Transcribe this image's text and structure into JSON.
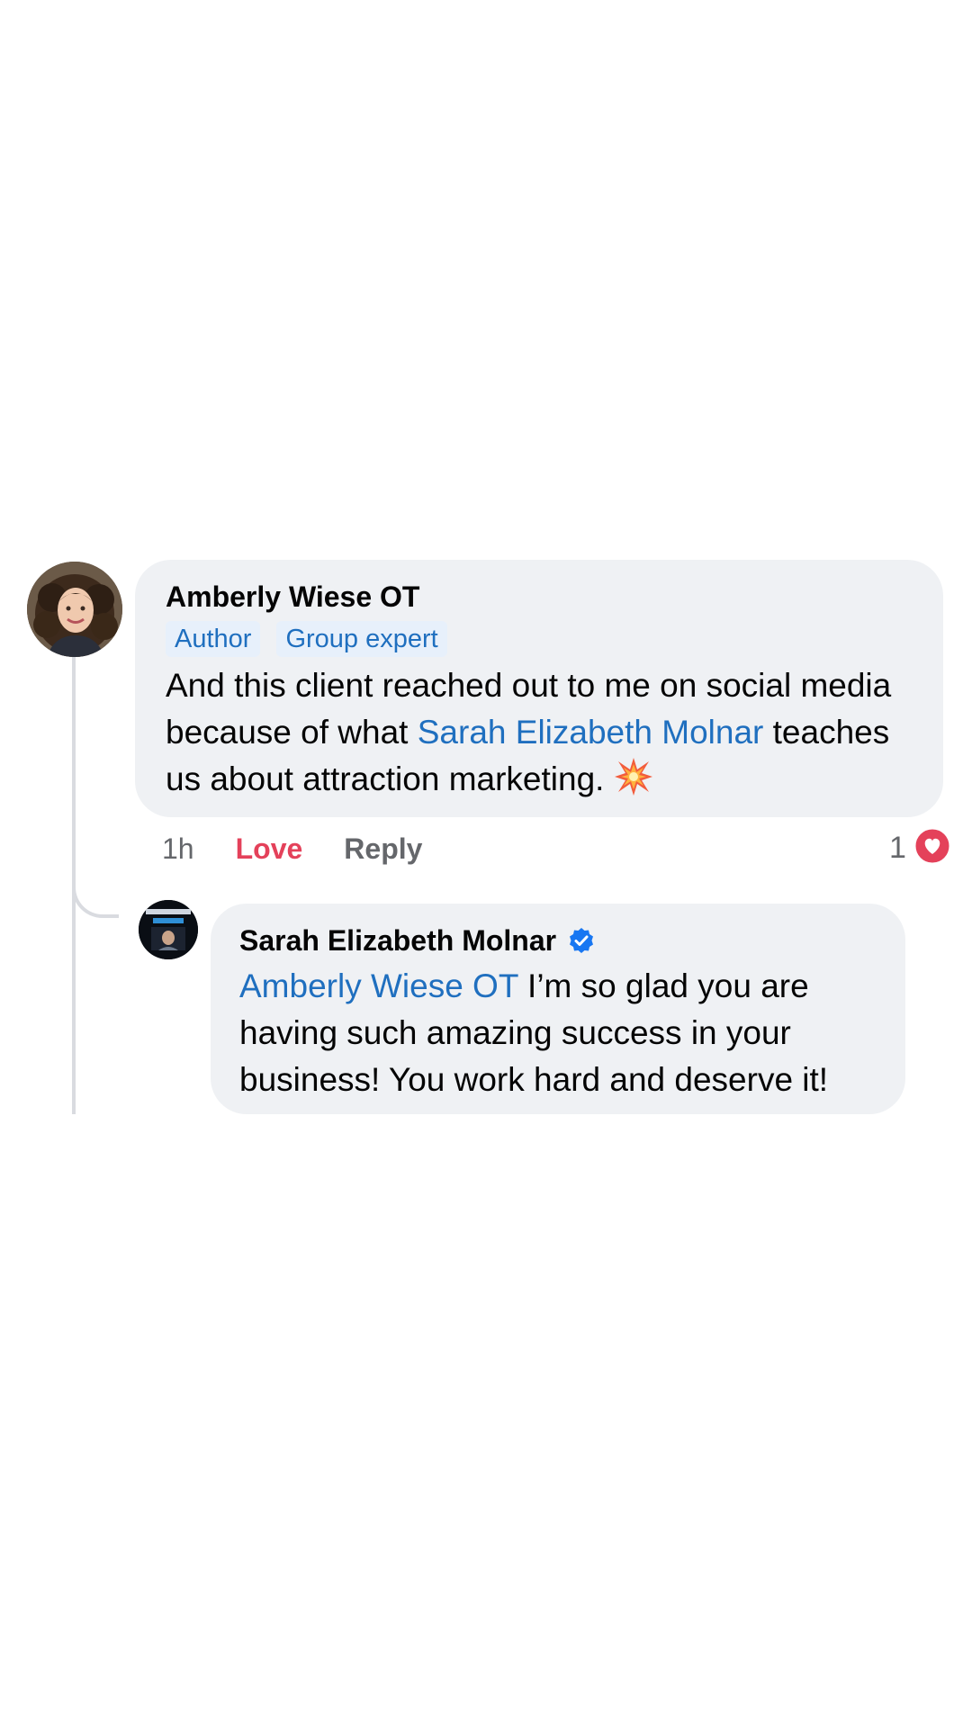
{
  "comment": {
    "author": "Amberly Wiese OT",
    "badges": [
      "Author",
      "Group expert"
    ],
    "text_part1": "And this client reached out to me on social media because of what ",
    "mention": "Sarah Elizabeth Molnar",
    "text_part2": " teaches us about attraction marketing.",
    "emoji_icon": "collision-burst-icon",
    "time": "1h",
    "love_label": "Love",
    "reply_label": "Reply",
    "reaction_count": "1",
    "reaction_icon": "heart-reaction-icon"
  },
  "reply": {
    "author": "Sarah Elizabeth Molnar",
    "verified_icon": "verified-badge-icon",
    "mention": "Amberly Wiese OT",
    "text": " I’m so glad you are having such amazing success in your business! You work hard and deserve it!"
  },
  "colors": {
    "bubble": "#eff1f4",
    "link": "#1f6fbf",
    "love": "#e4415a",
    "verified": "#1877f2",
    "heart": "#e4415a"
  }
}
